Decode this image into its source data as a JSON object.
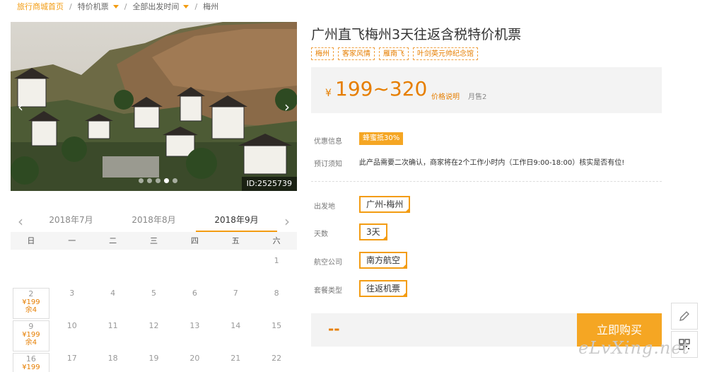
{
  "breadcrumb": {
    "home": "旅行商城首页",
    "category": "特价机票",
    "departure": "全部出发时间",
    "destination": "梅州"
  },
  "photo": {
    "image_id": "ID:2525739",
    "slide_count": 5,
    "active_slide": 3
  },
  "calendar": {
    "months": [
      "2018年7月",
      "2018年8月",
      "2018年9月"
    ],
    "active_month": 2,
    "weekdays": [
      "日",
      "一",
      "二",
      "三",
      "四",
      "五",
      "六"
    ],
    "rows": [
      [
        {
          "d": ""
        },
        {
          "d": ""
        },
        {
          "d": ""
        },
        {
          "d": ""
        },
        {
          "d": ""
        },
        {
          "d": ""
        },
        {
          "d": "1"
        }
      ],
      [
        {
          "d": "2",
          "price": "¥199",
          "rem": "余4"
        },
        {
          "d": "3"
        },
        {
          "d": "4"
        },
        {
          "d": "5"
        },
        {
          "d": "6"
        },
        {
          "d": "7"
        },
        {
          "d": "8"
        }
      ],
      [
        {
          "d": "9",
          "price": "¥199",
          "rem": "余4"
        },
        {
          "d": "10"
        },
        {
          "d": "11"
        },
        {
          "d": "12"
        },
        {
          "d": "13"
        },
        {
          "d": "14"
        },
        {
          "d": "15"
        }
      ],
      [
        {
          "d": "16",
          "price": "¥199",
          "rem": ""
        },
        {
          "d": "17"
        },
        {
          "d": "18"
        },
        {
          "d": "19"
        },
        {
          "d": "20"
        },
        {
          "d": "21"
        },
        {
          "d": "22"
        }
      ]
    ]
  },
  "product": {
    "title": "广州直飞梅州3天往返含税特价机票",
    "tags": [
      "梅州",
      "客家风情",
      "雁南飞",
      "叶剑英元帅纪念馆"
    ],
    "currency": "¥",
    "price": "199~320",
    "price_explain": "价格说明",
    "sold": "月售2"
  },
  "info": {
    "promo_label": "优惠信息",
    "promo_badge": "蜂蜜抵30%",
    "notice_label": "预订须知",
    "notice_text": "此产品需要二次确认，商家将在2个工作小时内（工作日9:00-18:00）核实是否有位!"
  },
  "options": {
    "departure_label": "出发地",
    "departure_value": "广州-梅州",
    "days_label": "天数",
    "days_value": "3天",
    "airline_label": "航空公司",
    "airline_value": "南方航空",
    "package_label": "套餐类型",
    "package_value": "往返机票"
  },
  "purchase": {
    "total": "--",
    "buy_label": "立即购买"
  },
  "side_tools": [
    "pencil-icon",
    "qrcode-icon"
  ],
  "watermark": "eLvXing.net",
  "colors": {
    "accent": "#f39c12",
    "price": "#e67e00",
    "button": "#f5a623"
  }
}
